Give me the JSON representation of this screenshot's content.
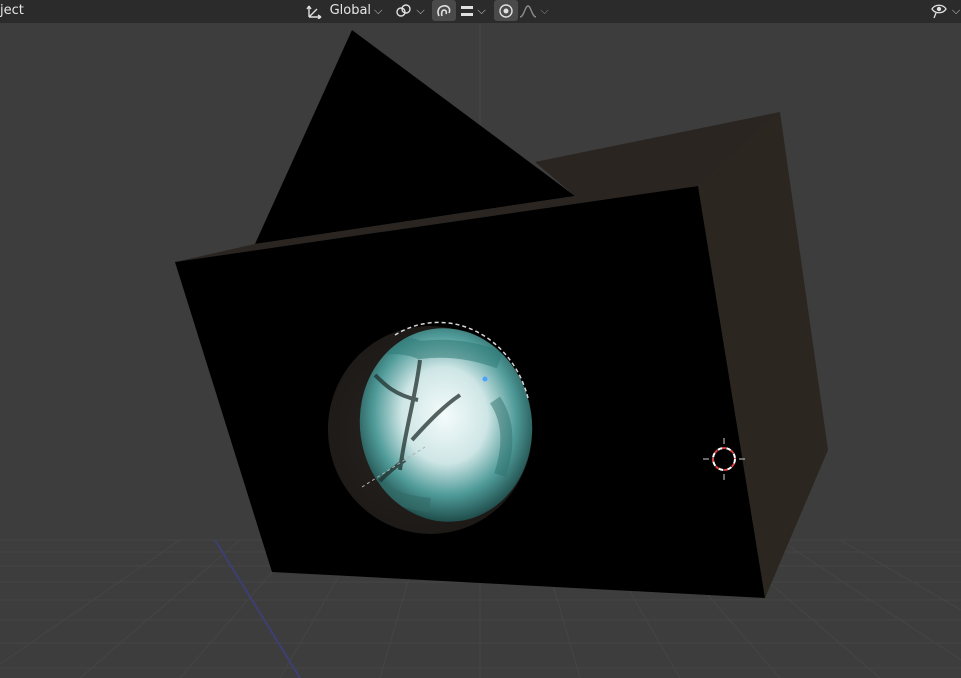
{
  "header": {
    "mode_label": "ject",
    "orientation": {
      "label": "Global",
      "icon": "transform-orientation-icon"
    },
    "pivot": {
      "icon": "pivot-link-icon"
    },
    "snap": {
      "icon": "snap-magnet-icon",
      "active": true
    },
    "snap_type": {
      "icon": "snap-increment-icon"
    },
    "proportional_editing": {
      "icon": "proportional-editing-icon",
      "active": true
    },
    "falloff": {
      "icon": "falloff-curve-icon"
    },
    "visibility": {
      "icon": "eye-visibility-icon"
    }
  },
  "viewport": {
    "background": "#3d3d3d",
    "grid_color": "#4a4a4a",
    "axis_color": "#3a3a6a",
    "object": "box-with-lens",
    "lens_image": "fisheye-tree-canopy",
    "cursor": "3d-cursor"
  }
}
